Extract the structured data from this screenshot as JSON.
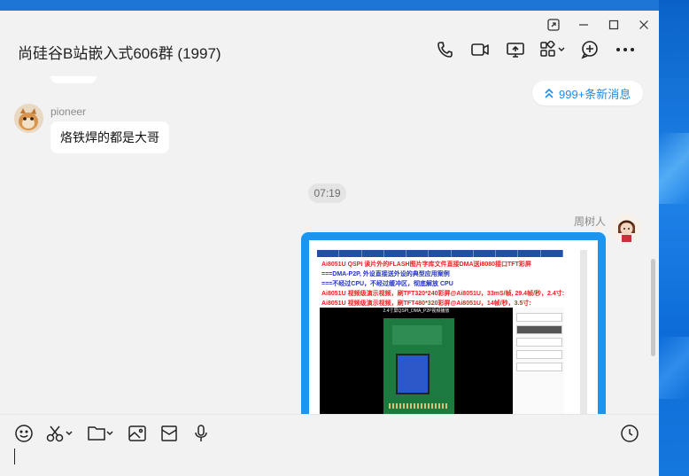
{
  "window": {
    "title": "尚硅谷B站嵌入式606群 (1997)",
    "controls": [
      "pin-window",
      "minimize",
      "maximize",
      "close"
    ]
  },
  "header_tools": [
    "phone-icon",
    "video-call-icon",
    "screen-share-icon",
    "apps-grid-icon",
    "add-icon",
    "more-icon"
  ],
  "unread_banner": {
    "text": "999+条新消息"
  },
  "messages": [
    {
      "sender": "pioneer",
      "text": "烙铁焊的都是大哥"
    },
    {
      "timestamp": "07:19"
    },
    {
      "sender": "周树人",
      "type": "image"
    }
  ],
  "shared_image": {
    "lines": [
      {
        "text": "Ai8051U QSPI 读片外的FLASH图片字库文件直接DMA送i8080接口TFT彩屏",
        "color": "red"
      },
      {
        "text": "===DMA-P2P, 外设直接送外设的典型应用案例",
        "color": "blue"
      },
      {
        "text": "===不经过CPU，不经过缓冲区，彻底解放 CPU",
        "color": "blue"
      },
      {
        "text": "Ai8051U 视频级演示视频，刷TFT320*240彩屏@Ai8051U，33mS/帧, 29.4帧/秒，2.4寸:",
        "color": "red"
      },
      {
        "text": "Ai8051U 视频级演示视频，刷TFT480*320彩屏@Ai8051U，14帧/秒，3.5寸:",
        "color": "red"
      }
    ],
    "video_title": "2.4寸屏QSPI_DMA_P2P视频播放"
  },
  "input_tools": [
    "emoji-icon",
    "scissors-icon",
    "folder-icon",
    "image-icon",
    "envelope-icon",
    "microphone-icon"
  ],
  "input": {
    "value": ""
  }
}
